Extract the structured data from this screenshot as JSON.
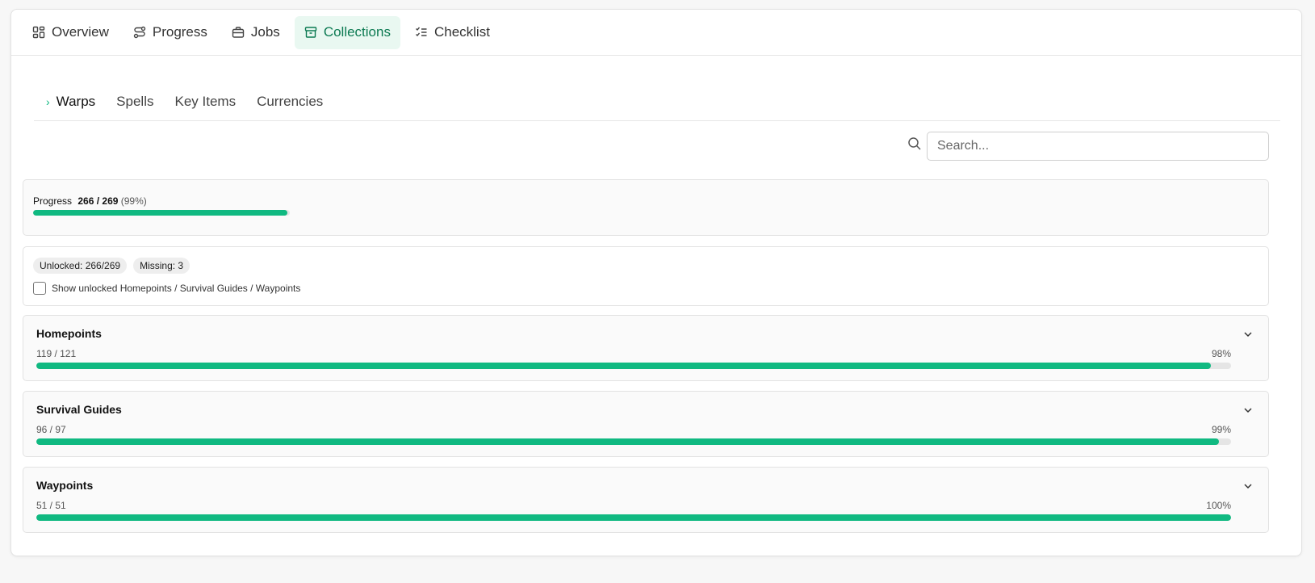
{
  "top_tabs": [
    {
      "label": "Overview",
      "icon": "dashboard-icon"
    },
    {
      "label": "Progress",
      "icon": "route-icon"
    },
    {
      "label": "Jobs",
      "icon": "briefcase-icon"
    },
    {
      "label": "Collections",
      "icon": "archive-icon",
      "active": true
    },
    {
      "label": "Checklist",
      "icon": "checklist-icon"
    }
  ],
  "sub_tabs": [
    {
      "label": "Warps",
      "active": true
    },
    {
      "label": "Spells"
    },
    {
      "label": "Key Items"
    },
    {
      "label": "Currencies"
    }
  ],
  "search": {
    "placeholder": "Search..."
  },
  "progress": {
    "label": "Progress",
    "count": "266 / 269",
    "percent_text": "(99%)",
    "fraction": 0.99
  },
  "summary": {
    "unlocked": "Unlocked: 266/269",
    "missing": "Missing: 3",
    "checkbox_label": "Show unlocked Homepoints / Survival Guides / Waypoints",
    "checked": false
  },
  "groups": [
    {
      "title": "Homepoints",
      "count": "119 / 121",
      "percent": "98%",
      "fraction": 0.983
    },
    {
      "title": "Survival Guides",
      "count": "96 / 97",
      "percent": "99%",
      "fraction": 0.99
    },
    {
      "title": "Waypoints",
      "count": "51 / 51",
      "percent": "100%",
      "fraction": 1.0
    }
  ],
  "colors": {
    "accent": "#10b981",
    "active_tab_bg": "#e9f8f1",
    "active_tab_text": "#0c7a52"
  }
}
